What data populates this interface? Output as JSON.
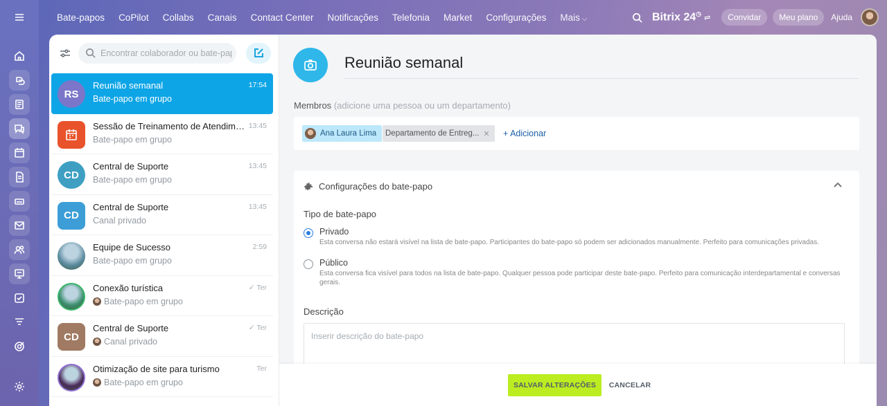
{
  "topnav": {
    "items": [
      "Bate-papos",
      "CoPilot",
      "Collabs",
      "Canais",
      "Contact Center",
      "Notificações",
      "Telefonia",
      "Market",
      "Configurações",
      "Mais"
    ],
    "brand": "Bitrix 24",
    "invite": "Convidar",
    "plan": "Meu plano",
    "help": "Ajuda"
  },
  "rail": [
    "menu-icon",
    "home-icon",
    "collab-icon",
    "feed-icon",
    "chat-icon",
    "calendar-icon",
    "document-icon",
    "drive-icon",
    "mail-icon",
    "contacts-icon",
    "sites-icon",
    "tasks-icon",
    "filter-funnel-icon",
    "target-icon",
    "settings-icon"
  ],
  "chatlist": {
    "search_placeholder": "Encontrar colaborador ou bate-papo",
    "items": [
      {
        "title": "Reunião semanal",
        "sub": "Bate-papo em grupo",
        "time": "17:54",
        "initials": "RS",
        "color": "#7b76c9",
        "active": true
      },
      {
        "title": "Sessão de Treinamento de Atendimento ao Cliente",
        "sub": "Bate-papo em grupo",
        "time": "13:45",
        "initials": "",
        "color": "#e9532b",
        "square": true
      },
      {
        "title": "Central de Suporte",
        "sub": "Bate-papo em grupo",
        "time": "13:45",
        "initials": "CD",
        "color": "#3e9fc3"
      },
      {
        "title": "Central de Suporte",
        "sub": "Canal privado",
        "time": "13:45",
        "initials": "CD",
        "color": "#3d9ed7",
        "square": true
      },
      {
        "title": "Equipe de Sucesso",
        "sub": "Bate-papo em grupo",
        "time": "2:59",
        "initials": "",
        "color": "#5a8a9e"
      },
      {
        "title": "Conexão turística",
        "sub": "Bate-papo em grupo",
        "time": "Ter",
        "initials": "",
        "color": "#3c8f6f",
        "check": true,
        "mini": true
      },
      {
        "title": "Central de Suporte",
        "sub": "Canal privado",
        "time": "Ter",
        "initials": "CD",
        "color": "#a07a62",
        "square": true,
        "check": true,
        "mini": true
      },
      {
        "title": "Otimização de site para turismo",
        "sub": "Bate-papo em grupo",
        "time": "Ter",
        "initials": "",
        "color": "#4a2a5a",
        "mini": true
      }
    ]
  },
  "main": {
    "title": "Reunião semanal",
    "members_label": "Membros",
    "members_hint": "(adicione uma pessoa ou um departamento)",
    "member1": "Ana Laura Lima",
    "member2": "Departamento de Entreg...",
    "add": "+ Adicionar",
    "settings_title": "Configurações do bate-papo",
    "type_label": "Tipo de bate-papo",
    "private_title": "Privado",
    "private_desc": "Esta conversa não estará visível na lista de bate-papo. Participantes do bate-papo só podem ser adicionados manualmente. Perfeito para comunicações privadas.",
    "public_title": "Público",
    "public_desc": "Esta conversa fica visível para todos na lista de bate-papo. Qualquer pessoa pode participar deste bate-papo. Perfeito para comunicação interdepartamental e conversas gerais.",
    "description_label": "Descrição",
    "description_placeholder": "Inserir descrição do bate-papo",
    "save": "SALVAR ALTERAÇÕES",
    "cancel": "CANCELAR"
  }
}
